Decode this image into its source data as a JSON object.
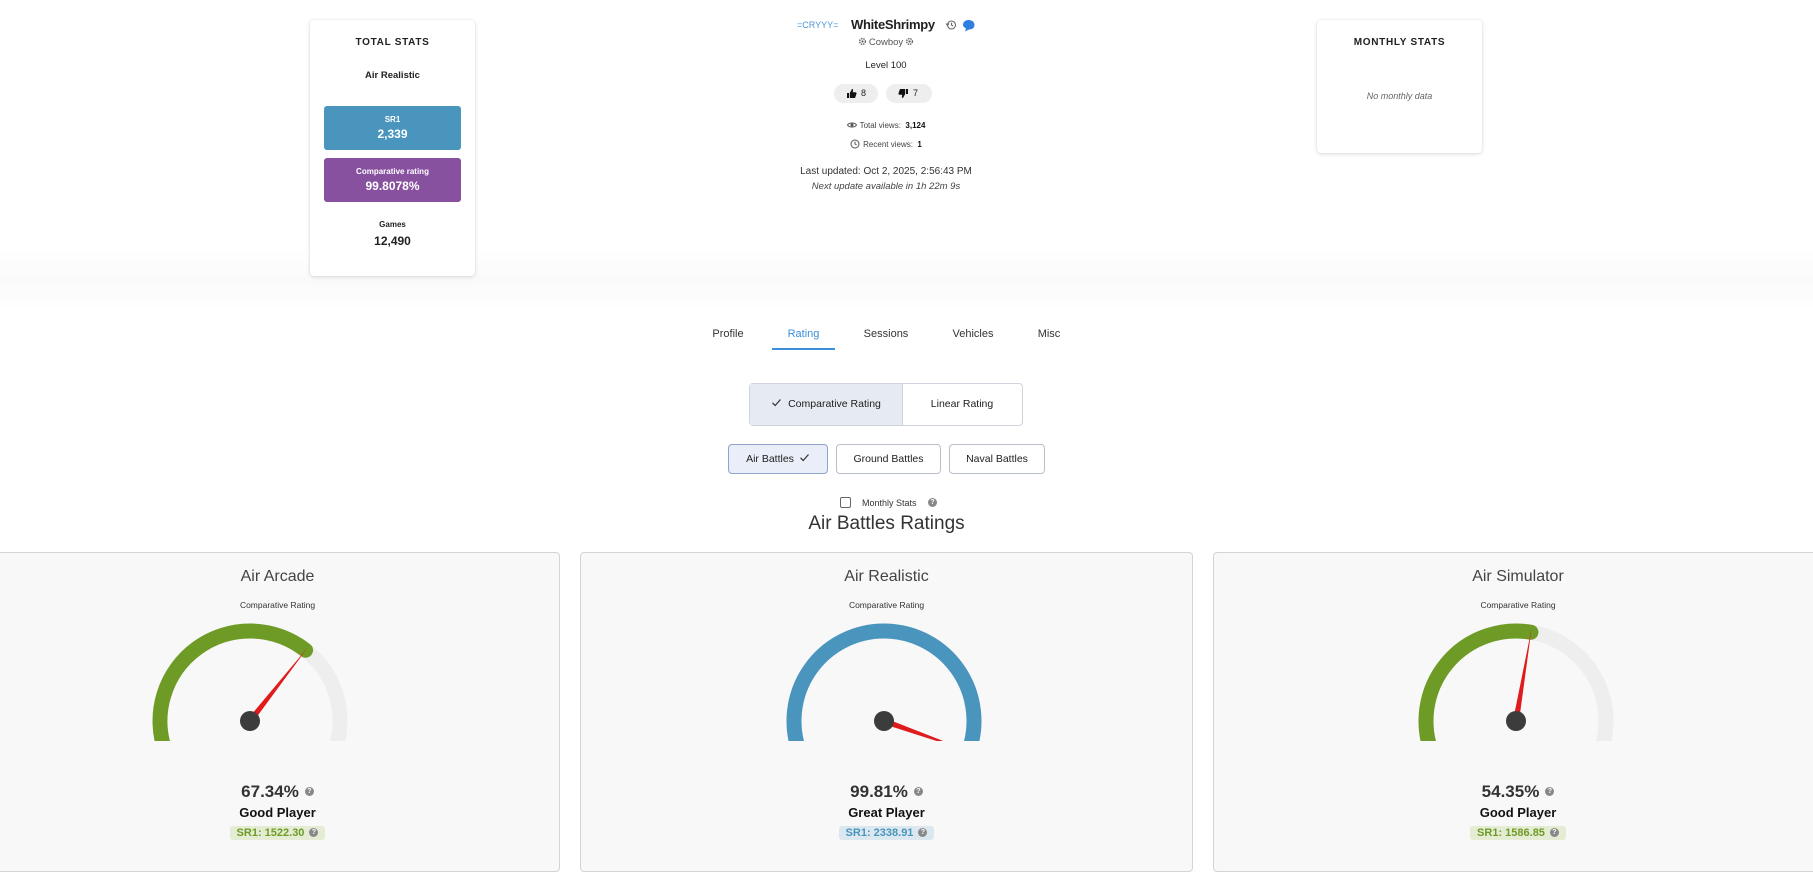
{
  "total_stats": {
    "title": "TOTAL STATS",
    "mode": "Air Realistic",
    "sr1_label": "SR1",
    "sr1_value": "2,339",
    "comparative_label": "Comparative rating",
    "comparative_value": "99.8078%",
    "games_label": "Games",
    "games_value": "12,490"
  },
  "monthly_stats": {
    "title": "MONTHLY STATS",
    "empty_text": "No monthly data"
  },
  "profile": {
    "clan_tag": "=CRYYY=",
    "name": "WhiteShrimpy",
    "title": "Cowboy",
    "level": "Level 100",
    "likes": "8",
    "dislikes": "7",
    "total_views_label": "Total views:",
    "total_views": "3,124",
    "recent_views_label": "Recent views:",
    "recent_views": "1",
    "last_updated": "Last updated: Oct 2, 2025, 2:56:43 PM",
    "next_update": "Next update available in 1h 22m 9s"
  },
  "tabs": [
    {
      "label": "Profile",
      "active": false
    },
    {
      "label": "Rating",
      "active": true
    },
    {
      "label": "Sessions",
      "active": false
    },
    {
      "label": "Vehicles",
      "active": false
    },
    {
      "label": "Misc",
      "active": false
    }
  ],
  "rating_toggle": {
    "options": [
      "Comparative Rating",
      "Linear Rating"
    ],
    "selected": "Comparative Rating"
  },
  "battle_types": {
    "options": [
      "Air Battles",
      "Ground Battles",
      "Naval Battles"
    ],
    "selected": "Air Battles"
  },
  "monthly_checkbox": {
    "label": "Monthly Stats",
    "checked": false
  },
  "section_title": "Air Battles Ratings",
  "gauges": [
    {
      "title": "Air Arcade",
      "subtitle": "Comparative Rating",
      "percent_value": 67.34,
      "percent": "67.34%",
      "classification": "Good Player",
      "sr": "SR1: 1522.30",
      "color": "#6e9b26",
      "badge_bg": "#e4edd3"
    },
    {
      "title": "Air Realistic",
      "subtitle": "Comparative Rating",
      "percent_value": 99.81,
      "percent": "99.81%",
      "classification": "Great Player",
      "sr": "SR1: 2338.91",
      "color": "#4a95bd",
      "badge_bg": "#dbe8ef"
    },
    {
      "title": "Air Simulator",
      "subtitle": "Comparative Rating",
      "percent_value": 54.35,
      "percent": "54.35%",
      "classification": "Good Player",
      "sr": "SR1: 1586.85",
      "color": "#6e9b26",
      "badge_bg": "#e4edd3"
    }
  ],
  "colors": {
    "accent": "#3a8fd8",
    "sr1_box": "#4a95bd",
    "comparative_box": "#8751a0",
    "needle": "#e01b1b"
  }
}
